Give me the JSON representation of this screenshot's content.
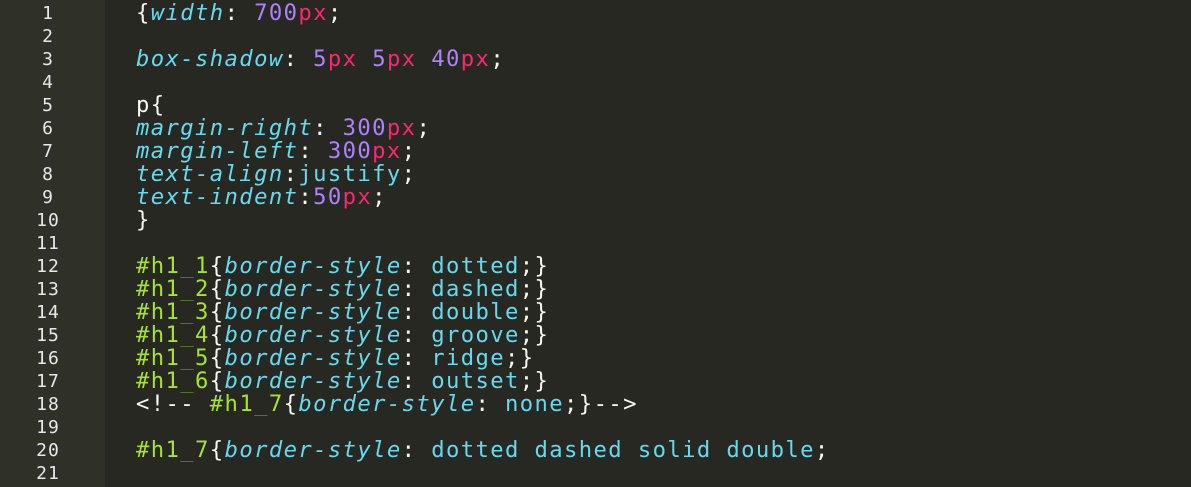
{
  "editor": {
    "colors": {
      "background": "#272822",
      "gutter": "#2f3129",
      "property": "#66d9ef",
      "number": "#ae81ff",
      "unit": "#f92672",
      "selector": "#a6e22e",
      "text": "#f8f8f2"
    },
    "lines": [
      {
        "number": "1",
        "tokens": [
          {
            "type": "punc",
            "text": "{"
          },
          {
            "type": "prop",
            "text": "width"
          },
          {
            "type": "punc",
            "text": ": "
          },
          {
            "type": "num",
            "text": "700"
          },
          {
            "type": "unit",
            "text": "px"
          },
          {
            "type": "punc",
            "text": ";"
          }
        ]
      },
      {
        "number": "2",
        "tokens": []
      },
      {
        "number": "3",
        "tokens": [
          {
            "type": "prop",
            "text": "box-shadow"
          },
          {
            "type": "punc",
            "text": ": "
          },
          {
            "type": "num",
            "text": "5"
          },
          {
            "type": "unit",
            "text": "px"
          },
          {
            "type": "punc",
            "text": " "
          },
          {
            "type": "num",
            "text": "5"
          },
          {
            "type": "unit",
            "text": "px"
          },
          {
            "type": "punc",
            "text": " "
          },
          {
            "type": "num",
            "text": "40"
          },
          {
            "type": "unit",
            "text": "px"
          },
          {
            "type": "punc",
            "text": ";"
          }
        ]
      },
      {
        "number": "4",
        "tokens": []
      },
      {
        "number": "5",
        "tokens": [
          {
            "type": "plain",
            "text": "p"
          },
          {
            "type": "punc",
            "text": "{"
          }
        ]
      },
      {
        "number": "6",
        "tokens": [
          {
            "type": "prop",
            "text": "margin-right"
          },
          {
            "type": "punc",
            "text": ": "
          },
          {
            "type": "num",
            "text": "300"
          },
          {
            "type": "unit",
            "text": "px"
          },
          {
            "type": "punc",
            "text": ";"
          }
        ]
      },
      {
        "number": "7",
        "tokens": [
          {
            "type": "prop",
            "text": "margin-left"
          },
          {
            "type": "punc",
            "text": ": "
          },
          {
            "type": "num",
            "text": "300"
          },
          {
            "type": "unit",
            "text": "px"
          },
          {
            "type": "punc",
            "text": ";"
          }
        ]
      },
      {
        "number": "8",
        "tokens": [
          {
            "type": "prop",
            "text": "text-align"
          },
          {
            "type": "punc",
            "text": ":"
          },
          {
            "type": "val",
            "text": "justify"
          },
          {
            "type": "punc",
            "text": ";"
          }
        ]
      },
      {
        "number": "9",
        "tokens": [
          {
            "type": "prop",
            "text": "text-indent"
          },
          {
            "type": "punc",
            "text": ":"
          },
          {
            "type": "num",
            "text": "50"
          },
          {
            "type": "unit",
            "text": "px"
          },
          {
            "type": "punc",
            "text": ";"
          }
        ]
      },
      {
        "number": "10",
        "tokens": [
          {
            "type": "punc",
            "text": "}"
          }
        ]
      },
      {
        "number": "11",
        "tokens": []
      },
      {
        "number": "12",
        "tokens": [
          {
            "type": "sel",
            "text": "#h1_1"
          },
          {
            "type": "punc",
            "text": "{"
          },
          {
            "type": "prop",
            "text": "border-style"
          },
          {
            "type": "punc",
            "text": ": "
          },
          {
            "type": "val",
            "text": "dotted"
          },
          {
            "type": "punc",
            "text": ";}"
          }
        ]
      },
      {
        "number": "13",
        "tokens": [
          {
            "type": "sel",
            "text": "#h1_2"
          },
          {
            "type": "punc",
            "text": "{"
          },
          {
            "type": "prop",
            "text": "border-style"
          },
          {
            "type": "punc",
            "text": ": "
          },
          {
            "type": "val",
            "text": "dashed"
          },
          {
            "type": "punc",
            "text": ";}"
          }
        ]
      },
      {
        "number": "14",
        "tokens": [
          {
            "type": "sel",
            "text": "#h1_3"
          },
          {
            "type": "punc",
            "text": "{"
          },
          {
            "type": "prop",
            "text": "border-style"
          },
          {
            "type": "punc",
            "text": ": "
          },
          {
            "type": "val",
            "text": "double"
          },
          {
            "type": "punc",
            "text": ";}"
          }
        ]
      },
      {
        "number": "15",
        "tokens": [
          {
            "type": "sel",
            "text": "#h1_4"
          },
          {
            "type": "punc",
            "text": "{"
          },
          {
            "type": "prop",
            "text": "border-style"
          },
          {
            "type": "punc",
            "text": ": "
          },
          {
            "type": "val",
            "text": "groove"
          },
          {
            "type": "punc",
            "text": ";}"
          }
        ]
      },
      {
        "number": "16",
        "tokens": [
          {
            "type": "sel",
            "text": "#h1_5"
          },
          {
            "type": "punc",
            "text": "{"
          },
          {
            "type": "prop",
            "text": "border-style"
          },
          {
            "type": "punc",
            "text": ": "
          },
          {
            "type": "val",
            "text": "ridge"
          },
          {
            "type": "punc",
            "text": ";}"
          }
        ]
      },
      {
        "number": "17",
        "tokens": [
          {
            "type": "sel",
            "text": "#h1_6"
          },
          {
            "type": "punc",
            "text": "{"
          },
          {
            "type": "prop",
            "text": "border-style"
          },
          {
            "type": "punc",
            "text": ": "
          },
          {
            "type": "val",
            "text": "outset"
          },
          {
            "type": "punc",
            "text": ";}"
          }
        ]
      },
      {
        "number": "18",
        "tokens": [
          {
            "type": "comment",
            "text": "<!-- "
          },
          {
            "type": "sel",
            "text": "#h1_7"
          },
          {
            "type": "punc",
            "text": "{"
          },
          {
            "type": "prop",
            "text": "border-style"
          },
          {
            "type": "punc",
            "text": ": "
          },
          {
            "type": "val",
            "text": "none"
          },
          {
            "type": "punc",
            "text": ";}"
          },
          {
            "type": "comment",
            "text": "-->"
          }
        ]
      },
      {
        "number": "19",
        "tokens": []
      },
      {
        "number": "20",
        "tokens": [
          {
            "type": "sel",
            "text": "#h1_7"
          },
          {
            "type": "punc",
            "text": "{"
          },
          {
            "type": "prop",
            "text": "border-style"
          },
          {
            "type": "punc",
            "text": ": "
          },
          {
            "type": "val",
            "text": "dotted dashed solid double"
          },
          {
            "type": "punc",
            "text": ";"
          }
        ]
      },
      {
        "number": "21",
        "tokens": []
      }
    ]
  }
}
